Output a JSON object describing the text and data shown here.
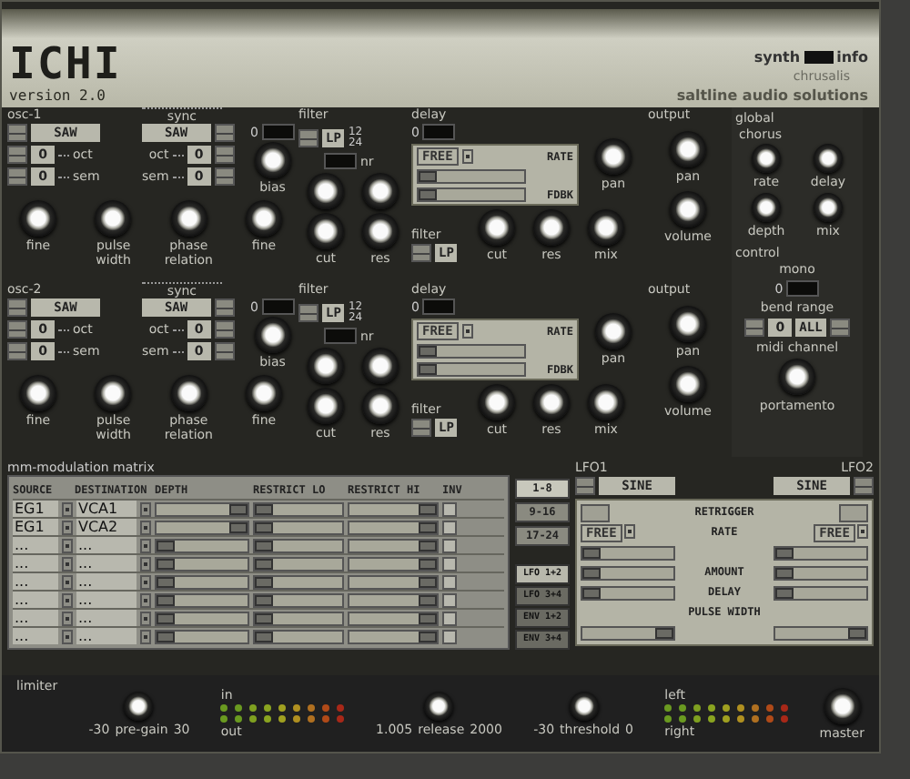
{
  "header": {
    "logo": "ICHI",
    "version": "version 2.0",
    "menu": [
      {
        "label": "synth"
      },
      {
        "label": "info"
      }
    ],
    "preset": "chrusalis",
    "company": "saltline audio solutions"
  },
  "voices": [
    {
      "osc": {
        "label": "osc-1",
        "sync_label": "sync",
        "sync_value": "0",
        "sync_on": false,
        "bias_label": "bias",
        "sides": [
          {
            "wave": "SAW",
            "oct": "0",
            "oct_label": "oct",
            "sem": "0",
            "sem_label": "sem"
          },
          {
            "wave": "SAW",
            "oct": "0",
            "oct_label": "oct",
            "sem": "0",
            "sem_label": "sem"
          }
        ],
        "knobs": [
          "fine",
          "pulse width",
          "phase relation",
          "fine"
        ]
      },
      "filter": {
        "label": "filter",
        "type": "LP",
        "slopes": [
          "12",
          "24"
        ],
        "nr_label": "nr",
        "nr_on": false,
        "knobs": [
          "cut",
          "res"
        ]
      },
      "delay": {
        "label": "delay",
        "toggle_value": "0",
        "on": false,
        "mode": "FREE",
        "rate_label": "RATE",
        "feedback_label": "FDBK",
        "rate": {
          "level": 0
        },
        "feedback": {
          "level": 0
        },
        "pan_label": "pan",
        "filter_label": "filter",
        "filter_type": "LP",
        "knobs": [
          "cut",
          "res",
          "mix"
        ]
      },
      "output": {
        "label": "output",
        "knobs": [
          "pan",
          "volume"
        ]
      }
    },
    {
      "osc": {
        "label": "osc-2",
        "sync_label": "sync",
        "sync_value": "0",
        "sync_on": false,
        "bias_label": "bias",
        "sides": [
          {
            "wave": "SAW",
            "oct": "0",
            "oct_label": "oct",
            "sem": "0",
            "sem_label": "sem"
          },
          {
            "wave": "SAW",
            "oct": "0",
            "oct_label": "oct",
            "sem": "0",
            "sem_label": "sem"
          }
        ],
        "knobs": [
          "fine",
          "pulse width",
          "phase relation",
          "fine"
        ]
      },
      "filter": {
        "label": "filter",
        "type": "LP",
        "slopes": [
          "12",
          "24"
        ],
        "nr_label": "nr",
        "nr_on": false,
        "knobs": [
          "cut",
          "res"
        ]
      },
      "delay": {
        "label": "delay",
        "toggle_value": "0",
        "on": false,
        "mode": "FREE",
        "rate_label": "RATE",
        "feedback_label": "FDBK",
        "rate": {
          "level": 0
        },
        "feedback": {
          "level": 0
        },
        "pan_label": "pan",
        "filter_label": "filter",
        "filter_type": "LP",
        "knobs": [
          "cut",
          "res",
          "mix"
        ]
      },
      "output": {
        "label": "output",
        "knobs": [
          "pan",
          "volume"
        ]
      }
    }
  ],
  "global": {
    "label": "global",
    "chorus_label": "chorus",
    "chorus_knobs": [
      "rate",
      "delay",
      "depth",
      "mix"
    ],
    "control_label": "control",
    "mono_label": "mono",
    "mono_value": "0",
    "mono_on": false,
    "bend_label": "bend range",
    "bend_value": "0",
    "channel_value": "ALL",
    "channel_label": "midi channel",
    "portamento_label": "portamento"
  },
  "matrix": {
    "title": "mm-modulation matrix",
    "columns": [
      "SOURCE",
      "DESTINATION",
      "DEPTH",
      "RESTRICT LO",
      "RESTRICT HI",
      "INV"
    ],
    "rows": [
      {
        "source": "EG1",
        "destination": "VCA1",
        "depth": {
          "level": 1
        },
        "restrict_lo": {
          "level": 0
        },
        "restrict_hi": {
          "level": 1
        },
        "inverted": false
      },
      {
        "source": "EG1",
        "destination": "VCA2",
        "depth": {
          "level": 1
        },
        "restrict_lo": {
          "level": 0
        },
        "restrict_hi": {
          "level": 1
        },
        "inverted": false
      },
      {
        "source": "...",
        "destination": "...",
        "depth": {
          "level": 0
        },
        "restrict_lo": {
          "level": 0
        },
        "restrict_hi": {
          "level": 1
        },
        "inverted": false
      },
      {
        "source": "...",
        "destination": "...",
        "depth": {
          "level": 0
        },
        "restrict_lo": {
          "level": 0
        },
        "restrict_hi": {
          "level": 1
        },
        "inverted": false
      },
      {
        "source": "...",
        "destination": "...",
        "depth": {
          "level": 0
        },
        "restrict_lo": {
          "level": 0
        },
        "restrict_hi": {
          "level": 1
        },
        "inverted": false
      },
      {
        "source": "...",
        "destination": "...",
        "depth": {
          "level": 0
        },
        "restrict_lo": {
          "level": 0
        },
        "restrict_hi": {
          "level": 1
        },
        "inverted": false
      },
      {
        "source": "...",
        "destination": "...",
        "depth": {
          "level": 0
        },
        "restrict_lo": {
          "level": 0
        },
        "restrict_hi": {
          "level": 1
        },
        "inverted": false
      },
      {
        "source": "...",
        "destination": "...",
        "depth": {
          "level": 0
        },
        "restrict_lo": {
          "level": 0
        },
        "restrict_hi": {
          "level": 1
        },
        "inverted": false
      }
    ],
    "pages": [
      {
        "label": "1-8",
        "selected": true
      },
      {
        "label": "9-16",
        "selected": false
      },
      {
        "label": "17-24",
        "selected": false
      }
    ]
  },
  "lfo": {
    "lfos": [
      {
        "label": "LFO1",
        "wave": "SINE",
        "retrigger": false,
        "mode": "FREE",
        "rate": {
          "level": 0
        },
        "amount": {
          "level": 0
        },
        "delay": {
          "level": 0
        },
        "pulse_width": {
          "level": 1
        }
      },
      {
        "label": "LFO2",
        "wave": "SINE",
        "retrigger": false,
        "mode": "FREE",
        "rate": {
          "level": 0
        },
        "amount": {
          "level": 0
        },
        "delay": {
          "level": 0
        },
        "pulse_width": {
          "level": 1
        }
      }
    ],
    "retrigger_label": "RETRIGGER",
    "rate_label": "RATE",
    "amount_label": "AMOUNT",
    "delay_label": "DELAY",
    "pw_label": "PULSE WIDTH",
    "tabs": [
      {
        "label": "LFO 1+2",
        "selected": true
      },
      {
        "label": "LFO 3+4",
        "selected": false
      },
      {
        "label": "ENV 1+2",
        "selected": false
      },
      {
        "label": "ENV 3+4",
        "selected": false
      }
    ]
  },
  "bottom": {
    "limiter_label": "limiter",
    "in_label": "in",
    "out_label": "out",
    "pregain_min": "-30",
    "pregain_max": "30",
    "pregain_label": "pre-gain",
    "release_min": "1.005",
    "release_max": "2000",
    "release_label": "release",
    "threshold_min": "-30",
    "threshold_max": "0",
    "threshold_label": "threshold",
    "left_label": "left",
    "right_label": "right",
    "master_label": "master"
  }
}
